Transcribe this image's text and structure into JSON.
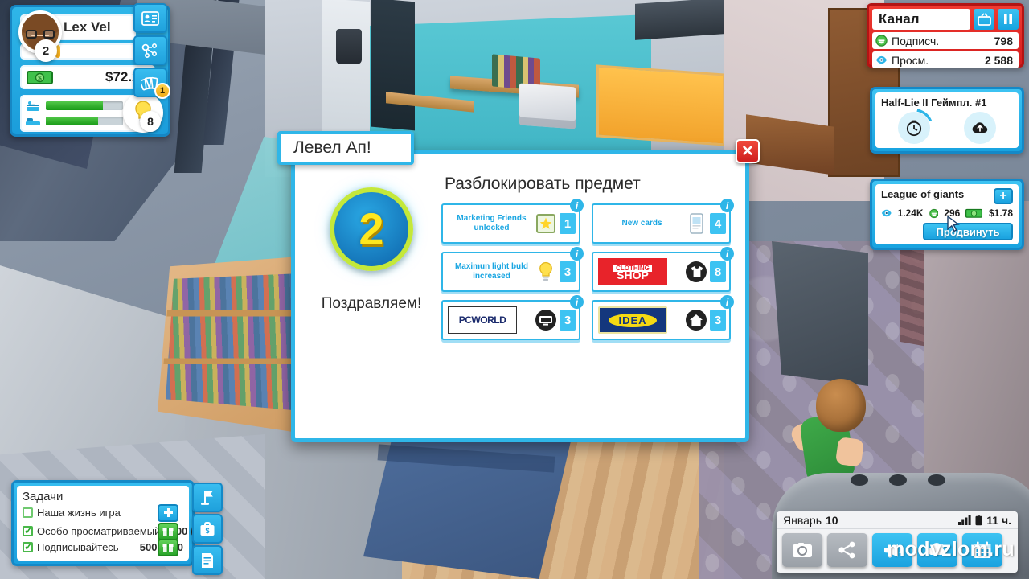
{
  "player": {
    "name": "Lex Vel",
    "level": "2",
    "money": "$72.27",
    "bulb_count": "8",
    "xp_percent": 22,
    "bar_food_percent": 74,
    "bar_bed_percent": 68,
    "avatar_icon": "avatar-bearded-man",
    "money_icon": "money-bill-icon",
    "food_icon": "food-icon",
    "bed_icon": "bed-icon",
    "bulb_icon": "lightbulb-icon",
    "side_buttons": [
      {
        "name": "profile-card-icon",
        "badge": ""
      },
      {
        "name": "network-share-icon",
        "badge": ""
      },
      {
        "name": "cards-icon",
        "badge": "1"
      }
    ]
  },
  "channel": {
    "title": "Канал",
    "tv_icon": "tv-icon",
    "pause_icon": "pause-icon",
    "stats": [
      {
        "icon": "subscriber-face-icon",
        "label": "Подписч.",
        "value": "798"
      },
      {
        "icon": "eye-icon",
        "label": "Просм.",
        "value": "2 588"
      }
    ]
  },
  "video_upload": {
    "title": "Half-Lie II Геймпл. #1",
    "timer_icon": "clock-timer-icon",
    "upload_icon": "cloud-upload-icon"
  },
  "video_published": {
    "title": "League of giants",
    "plus_label": "+",
    "views_icon": "eye-icon",
    "views": "1.24K",
    "likes_icon": "subscriber-face-icon",
    "likes": "296",
    "money_icon": "money-bill-icon",
    "money": "$1.78",
    "promote_label": "Продвинуть"
  },
  "tasks": {
    "title": "Задачи",
    "items": [
      {
        "label": "Наша жизнь игра",
        "count": "",
        "checked": false,
        "button": "+",
        "button_style": "blue",
        "button_icon": "plus-icon"
      },
      {
        "label": "Особо просматриваемый",
        "count": "1000 / 1000",
        "checked": true,
        "button": "",
        "button_style": "green",
        "button_icon": "gift-icon"
      },
      {
        "label": "Подписывайтесь",
        "count": "500 / 500",
        "checked": true,
        "button": "",
        "button_style": "green",
        "button_icon": "gift-icon"
      }
    ],
    "side_buttons": [
      {
        "name": "flag-icon"
      },
      {
        "name": "briefcase-dollar-icon"
      },
      {
        "name": "document-list-icon"
      }
    ]
  },
  "phone": {
    "month": "Январь",
    "day": "10",
    "signal_icon": "signal-bars-icon",
    "battery_icon": "battery-icon",
    "time": "11 ч.",
    "apps": [
      {
        "name": "camera-app-icon",
        "style": "grey"
      },
      {
        "name": "share-app-icon",
        "style": "grey"
      },
      {
        "name": "megaphone-app-icon",
        "style": "blue"
      },
      {
        "name": "weather-app-icon",
        "style": "blue"
      },
      {
        "name": "calendar-app-icon",
        "style": "blue"
      }
    ]
  },
  "watermark": "modvzlom.ru",
  "modal": {
    "tab_title": "Левел Ап!",
    "close_label": "✕",
    "level_number": "2",
    "congrats": "Поздравляем!",
    "unlock_title": "Разблокировать предмет",
    "rewards": [
      {
        "text": "Marketing Friends unlocked",
        "qty": "1",
        "icon": "star-frame-icon",
        "logo": "",
        "info": "i"
      },
      {
        "text": "New cards",
        "qty": "4",
        "icon": "card-phone-icon",
        "logo": "",
        "info": "i"
      },
      {
        "text": "Maximun light buld increased",
        "qty": "3",
        "icon": "lightbulb-icon",
        "logo": "",
        "info": "i"
      },
      {
        "text": "",
        "qty": "8",
        "icon": "tshirt-icon",
        "logo": "CLOTHING SHOP",
        "logo_style": "clothing",
        "info": "i"
      },
      {
        "text": "",
        "qty": "3",
        "icon": "monitor-icon",
        "logo": "PCWORLD",
        "logo_style": "pcworld",
        "info": "i"
      },
      {
        "text": "",
        "qty": "3",
        "icon": "home-icon",
        "logo": "IDEA",
        "logo_style": "idea",
        "info": "i"
      }
    ]
  },
  "colors": {
    "accent_blue": "#2fb6e8",
    "accent_red": "#e8232a",
    "accent_green": "#2aa52a",
    "accent_yellow": "#ffe71e"
  }
}
